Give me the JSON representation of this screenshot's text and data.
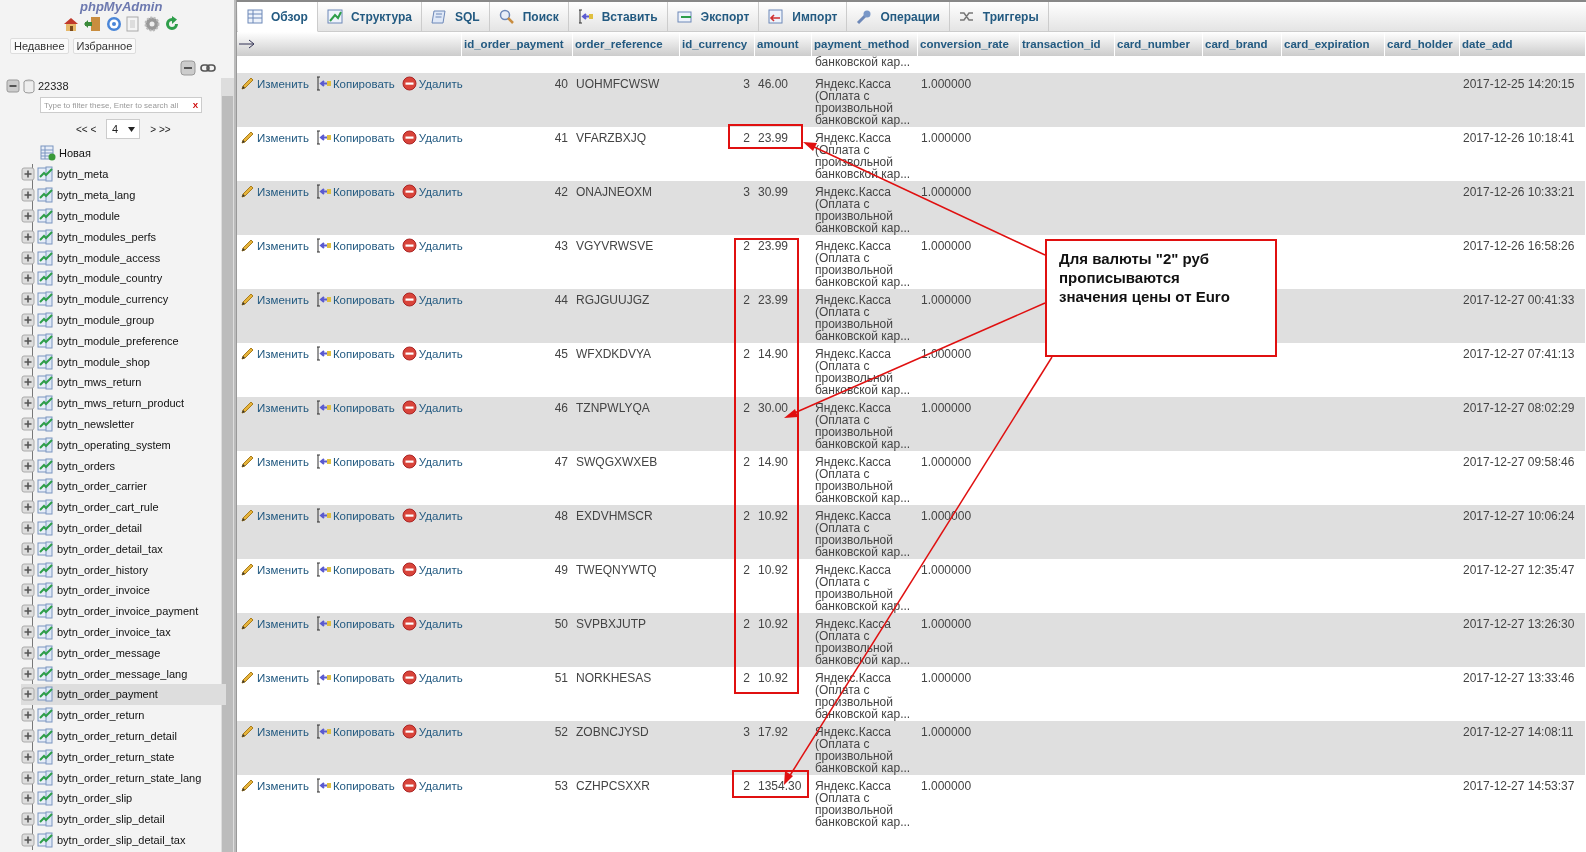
{
  "sidebar": {
    "logo": "phpMyAdmin",
    "tabs": [
      {
        "label": "Недавнее"
      },
      {
        "label": "Избранное"
      }
    ],
    "database": {
      "name": "22338",
      "filter": {
        "placeholder": "Type to filter these, Enter to search all",
        "clear": "X"
      },
      "pager": {
        "first": "<< <",
        "page": "4",
        "next": "> >>"
      },
      "new_item": "Новая",
      "tables": [
        {
          "name": "bytn_meta",
          "selected": false
        },
        {
          "name": "bytn_meta_lang",
          "selected": false
        },
        {
          "name": "bytn_module",
          "selected": false
        },
        {
          "name": "bytn_modules_perfs",
          "selected": false
        },
        {
          "name": "bytn_module_access",
          "selected": false
        },
        {
          "name": "bytn_module_country",
          "selected": false
        },
        {
          "name": "bytn_module_currency",
          "selected": false
        },
        {
          "name": "bytn_module_group",
          "selected": false
        },
        {
          "name": "bytn_module_preference",
          "selected": false
        },
        {
          "name": "bytn_module_shop",
          "selected": false
        },
        {
          "name": "bytn_mws_return",
          "selected": false
        },
        {
          "name": "bytn_mws_return_product",
          "selected": false
        },
        {
          "name": "bytn_newsletter",
          "selected": false
        },
        {
          "name": "bytn_operating_system",
          "selected": false
        },
        {
          "name": "bytn_orders",
          "selected": false
        },
        {
          "name": "bytn_order_carrier",
          "selected": false
        },
        {
          "name": "bytn_order_cart_rule",
          "selected": false
        },
        {
          "name": "bytn_order_detail",
          "selected": false
        },
        {
          "name": "bytn_order_detail_tax",
          "selected": false
        },
        {
          "name": "bytn_order_history",
          "selected": false
        },
        {
          "name": "bytn_order_invoice",
          "selected": false
        },
        {
          "name": "bytn_order_invoice_payment",
          "selected": false
        },
        {
          "name": "bytn_order_invoice_tax",
          "selected": false
        },
        {
          "name": "bytn_order_message",
          "selected": false
        },
        {
          "name": "bytn_order_message_lang",
          "selected": false
        },
        {
          "name": "bytn_order_payment",
          "selected": true
        },
        {
          "name": "bytn_order_return",
          "selected": false
        },
        {
          "name": "bytn_order_return_detail",
          "selected": false
        },
        {
          "name": "bytn_order_return_state",
          "selected": false
        },
        {
          "name": "bytn_order_return_state_lang",
          "selected": false
        },
        {
          "name": "bytn_order_slip",
          "selected": false
        },
        {
          "name": "bytn_order_slip_detail",
          "selected": false
        },
        {
          "name": "bytn_order_slip_detail_tax",
          "selected": false
        }
      ]
    }
  },
  "tabs": [
    {
      "label": "Обзор",
      "selected": true
    },
    {
      "label": "Структура",
      "selected": false
    },
    {
      "label": "SQL",
      "selected": false
    },
    {
      "label": "Поиск",
      "selected": false
    },
    {
      "label": "Вставить",
      "selected": false
    },
    {
      "label": "Экспорт",
      "selected": false
    },
    {
      "label": "Импорт",
      "selected": false
    },
    {
      "label": "Операции",
      "selected": false
    },
    {
      "label": "Триггеры",
      "selected": false
    }
  ],
  "table": {
    "columns": [
      "id_order_payment",
      "order_reference",
      "id_currency",
      "amount",
      "payment_method",
      "conversion_rate",
      "transaction_id",
      "card_number",
      "card_brand",
      "card_expiration",
      "card_holder",
      "date_add"
    ],
    "partial_row": {
      "payment_method": "банковской кар..."
    },
    "rows": [
      {
        "actions": [
          "Изменить",
          "Копировать",
          "Удалить"
        ],
        "id_order_payment": "40",
        "order_reference": "UOHMFCWSW",
        "id_currency": "3",
        "amount": "46.00",
        "payment_method": "Яндекс.Касса (Оплата с произвольной банковской кар...",
        "conversion_rate": "1.000000",
        "date_add": "2017-12-25 14:20:15"
      },
      {
        "actions": [
          "Изменить",
          "Копировать",
          "Удалить"
        ],
        "id_order_payment": "41",
        "order_reference": "VFARZBXJQ",
        "id_currency": "2",
        "amount": "23.99",
        "payment_method": "Яндекс.Касса (Оплата с произвольной банковской кар...",
        "conversion_rate": "1.000000",
        "date_add": "2017-12-26 10:18:41"
      },
      {
        "actions": [
          "Изменить",
          "Копировать",
          "Удалить"
        ],
        "id_order_payment": "42",
        "order_reference": "ONAJNEOXM",
        "id_currency": "3",
        "amount": "30.99",
        "payment_method": "Яндекс.Касса (Оплата с произвольной банковской кар...",
        "conversion_rate": "1.000000",
        "date_add": "2017-12-26 10:33:21"
      },
      {
        "actions": [
          "Изменить",
          "Копировать",
          "Удалить"
        ],
        "id_order_payment": "43",
        "order_reference": "VGYVRWSVE",
        "id_currency": "2",
        "amount": "23.99",
        "payment_method": "Яндекс.Касса (Оплата с произвольной банковской кар...",
        "conversion_rate": "1.000000",
        "date_add": "2017-12-26 16:58:26"
      },
      {
        "actions": [
          "Изменить",
          "Копировать",
          "Удалить"
        ],
        "id_order_payment": "44",
        "order_reference": "RGJGUUJGZ",
        "id_currency": "2",
        "amount": "23.99",
        "payment_method": "Яндекс.Касса (Оплата с произвольной банковской кар...",
        "conversion_rate": "1.000000",
        "date_add": "2017-12-27 00:41:33"
      },
      {
        "actions": [
          "Изменить",
          "Копировать",
          "Удалить"
        ],
        "id_order_payment": "45",
        "order_reference": "WFXDKDVYA",
        "id_currency": "2",
        "amount": "14.90",
        "payment_method": "Яндекс.Касса (Оплата с произвольной банковской кар...",
        "conversion_rate": "1.000000",
        "date_add": "2017-12-27 07:41:13"
      },
      {
        "actions": [
          "Изменить",
          "Копировать",
          "Удалить"
        ],
        "id_order_payment": "46",
        "order_reference": "TZNPWLYQA",
        "id_currency": "2",
        "amount": "30.00",
        "payment_method": "Яндекс.Касса (Оплата с произвольной банковской кар...",
        "conversion_rate": "1.000000",
        "date_add": "2017-12-27 08:02:29"
      },
      {
        "actions": [
          "Изменить",
          "Копировать",
          "Удалить"
        ],
        "id_order_payment": "47",
        "order_reference": "SWQGXWXEB",
        "id_currency": "2",
        "amount": "14.90",
        "payment_method": "Яндекс.Касса (Оплата с произвольной банковской кар...",
        "conversion_rate": "1.000000",
        "date_add": "2017-12-27 09:58:46"
      },
      {
        "actions": [
          "Изменить",
          "Копировать",
          "Удалить"
        ],
        "id_order_payment": "48",
        "order_reference": "EXDVHMSCR",
        "id_currency": "2",
        "amount": "10.92",
        "payment_method": "Яндекс.Касса (Оплата с произвольной банковской кар...",
        "conversion_rate": "1.000000",
        "date_add": "2017-12-27 10:06:24"
      },
      {
        "actions": [
          "Изменить",
          "Копировать",
          "Удалить"
        ],
        "id_order_payment": "49",
        "order_reference": "TWEQNYWTQ",
        "id_currency": "2",
        "amount": "10.92",
        "payment_method": "Яндекс.Касса (Оплата с произвольной банковской кар...",
        "conversion_rate": "1.000000",
        "date_add": "2017-12-27 12:35:47"
      },
      {
        "actions": [
          "Изменить",
          "Копировать",
          "Удалить"
        ],
        "id_order_payment": "50",
        "order_reference": "SVPBXJUTP",
        "id_currency": "2",
        "amount": "10.92",
        "payment_method": "Яндекс.Касса (Оплата с произвольной банковской кар...",
        "conversion_rate": "1.000000",
        "date_add": "2017-12-27 13:26:30"
      },
      {
        "actions": [
          "Изменить",
          "Копировать",
          "Удалить"
        ],
        "id_order_payment": "51",
        "order_reference": "NORKHESAS",
        "id_currency": "2",
        "amount": "10.92",
        "payment_method": "Яндекс.Касса (Оплата с произвольной банковской кар...",
        "conversion_rate": "1.000000",
        "date_add": "2017-12-27 13:33:46"
      },
      {
        "actions": [
          "Изменить",
          "Копировать",
          "Удалить"
        ],
        "id_order_payment": "52",
        "order_reference": "ZOBNCJYSD",
        "id_currency": "3",
        "amount": "17.92",
        "payment_method": "Яндекс.Касса (Оплата с произвольной банковской кар...",
        "conversion_rate": "1.000000",
        "date_add": "2017-12-27 14:08:11"
      },
      {
        "actions": [
          "Изменить",
          "Копировать",
          "Удалить"
        ],
        "id_order_payment": "53",
        "order_reference": "CZHPCSXXR",
        "id_currency": "2",
        "amount": "1354.30",
        "payment_method": "Яндекс.Касса (Оплата с произвольной банковской кар...",
        "conversion_rate": "1.000000",
        "date_add": "2017-12-27 14:53:37"
      }
    ]
  },
  "annotation": {
    "text": "Для валюты \"2\" руб прописываются значения цены от Euro"
  }
}
